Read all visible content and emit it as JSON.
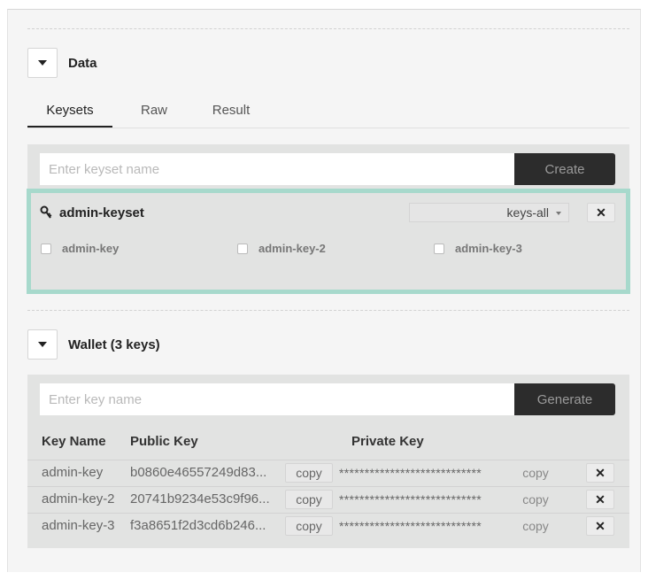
{
  "data_section": {
    "title": "Data",
    "tabs": [
      "Keysets",
      "Raw",
      "Result"
    ],
    "active_tab": "Keysets",
    "keyset_input_placeholder": "Enter keyset name",
    "create_label": "Create",
    "keyset": {
      "name": "admin-keyset",
      "predicate": "keys-all",
      "remove_label": "✕",
      "keys": [
        "admin-key",
        "admin-key-2",
        "admin-key-3"
      ]
    }
  },
  "wallet_section": {
    "title": "Wallet (3 keys)",
    "key_input_placeholder": "Enter key name",
    "generate_label": "Generate",
    "columns": [
      "Key Name",
      "Public Key",
      "Private Key"
    ],
    "copy_label": "copy",
    "remove_label": "✕",
    "rows": [
      {
        "name": "admin-key",
        "public": "b0860e46557249d83...",
        "private": "****************************"
      },
      {
        "name": "admin-key-2",
        "public": "20741b9234e53c9f96...",
        "private": "****************************"
      },
      {
        "name": "admin-key-3",
        "public": "f3a8651f2d3cd6b246...",
        "private": "****************************"
      }
    ]
  },
  "colors": {
    "panel_bg": "#f5f5f5",
    "box_bg": "#e2e3e2",
    "highlight_border": "#a7d9cc",
    "button_dark": "#2c2c2c"
  },
  "icons": {
    "toggle": "chevron-down-icon",
    "keyset": "key-icon",
    "remove": "close-icon"
  }
}
